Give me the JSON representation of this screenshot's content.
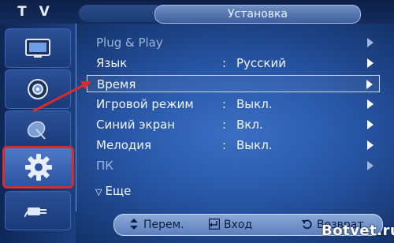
{
  "header": {
    "tv_label": "T V",
    "title": "Установка"
  },
  "menu": {
    "items": [
      {
        "label": "Plug & Play",
        "value": "",
        "state": "disabled"
      },
      {
        "label": "Язык",
        "value": "Русский",
        "state": "normal"
      },
      {
        "label": "Время",
        "value": "",
        "state": "highlighted"
      },
      {
        "label": "Игровой режим",
        "value": "Выкл.",
        "state": "normal"
      },
      {
        "label": "Синий экран",
        "value": "Вкл.",
        "state": "normal"
      },
      {
        "label": "Мелодия",
        "value": "Выкл.",
        "state": "normal"
      },
      {
        "label": "ПК",
        "value": "",
        "state": "disabled"
      }
    ],
    "colon": ":",
    "more_label": "Еще"
  },
  "sidebar": {
    "items": [
      "picture",
      "sound",
      "channel",
      "setup",
      "input"
    ],
    "selected_index": 3
  },
  "footer": {
    "move_label": "Перем.",
    "enter_label": "Вход",
    "return_label": "Возврат"
  },
  "watermark": "Botvet.ru",
  "colors": {
    "highlight_border": "#d92b2b",
    "background": "#2856a6",
    "annotation_arrow": "#d92b2b"
  }
}
